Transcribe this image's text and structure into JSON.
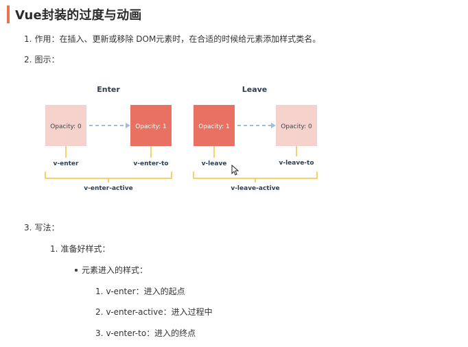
{
  "heading": {
    "title": "Vue封装的过度与动画"
  },
  "items": [
    {
      "num": "1.",
      "text": "作用：在插入、更新或移除 DOM元素时，在合适的时候给元素添加样式类名。"
    },
    {
      "num": "2.",
      "text": "图示："
    },
    {
      "num": "3.",
      "text": "写法："
    }
  ],
  "sub": {
    "num": "1.",
    "text": "准备好样式：",
    "bullet_text": "元素进入的样式：",
    "steps": [
      {
        "num": "1.",
        "text": "v-enter：进入的起点"
      },
      {
        "num": "2.",
        "text": "v-enter-active：进入过程中"
      },
      {
        "num": "3.",
        "text": "v-enter-to：进入的终点"
      }
    ]
  },
  "diagram": {
    "enter_title": "Enter",
    "leave_title": "Leave",
    "boxes": [
      {
        "text": "Opacity: 0",
        "label": "v-enter"
      },
      {
        "text": "Opacity: 1",
        "label": "v-enter-to"
      },
      {
        "text": "Opacity: 1",
        "label": "v-leave"
      },
      {
        "text": "Opacity: 0",
        "label": "v-leave-to"
      }
    ],
    "enter_active": "v-enter-active",
    "leave_active": "v-leave-active",
    "colors": {
      "light_box": "#f6d2cc",
      "dark_box": "#e87161",
      "arrow": "#9bbde6",
      "connector": "#f2c33d"
    }
  }
}
